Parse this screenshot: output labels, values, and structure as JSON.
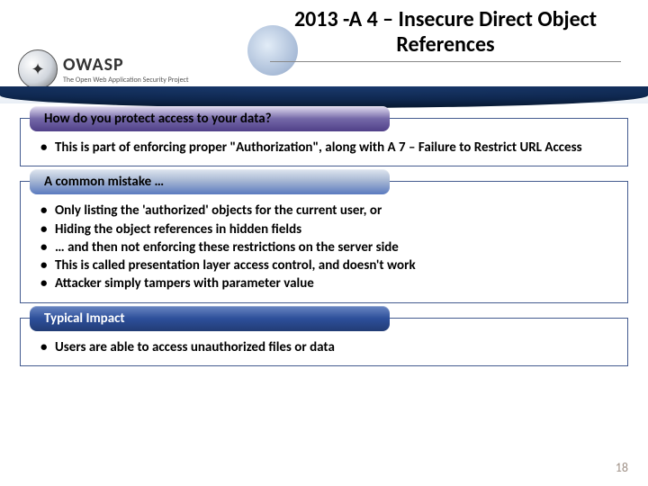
{
  "header": {
    "title": "2013 -A 4 – Insecure Direct Object References",
    "logo_name": "OWASP",
    "logo_tagline": "The Open Web Application Security Project"
  },
  "sections": [
    {
      "label": "How do you protect access to your data?",
      "bullets": [
        "This is part of enforcing proper \"Authorization\", along with A 7 – Failure to Restrict URL Access"
      ]
    },
    {
      "label": "A common mistake …",
      "bullets": [
        "Only listing the 'authorized' objects for the current user, or",
        "Hiding the object references in hidden fields",
        "… and then not enforcing these restrictions on the server side",
        "This is called presentation layer access control, and doesn't work",
        "Attacker simply tampers with parameter value"
      ]
    },
    {
      "label": "Typical Impact",
      "bullets": [
        "Users are able to access unauthorized files or data"
      ]
    }
  ],
  "page_number": "18"
}
